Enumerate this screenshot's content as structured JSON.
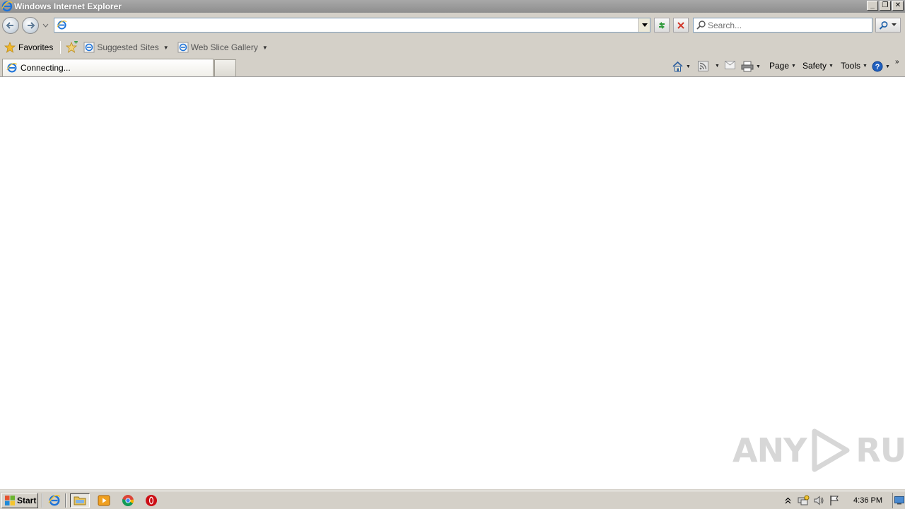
{
  "window": {
    "title": "Windows Internet Explorer",
    "buttons": [
      "minimize",
      "restore",
      "close"
    ]
  },
  "navbar": {
    "address": {
      "value": "",
      "placeholder": ""
    },
    "search": {
      "placeholder": "Search..."
    }
  },
  "favorites_bar": {
    "favorites_label": "Favorites",
    "links": [
      {
        "label": "Suggested Sites"
      },
      {
        "label": "Web Slice Gallery"
      }
    ]
  },
  "tabs": [
    {
      "label": "Connecting..."
    }
  ],
  "command_bar": {
    "page_label": "Page",
    "safety_label": "Safety",
    "tools_label": "Tools"
  },
  "watermark": {
    "text_left": "ANY",
    "text_right": "RUN"
  },
  "taskbar": {
    "start_label": "Start",
    "clock": "4:36 PM",
    "quick_launch": [
      "ie-icon",
      "explorer-icon",
      "media-player-icon",
      "chrome-icon",
      "opera-icon"
    ]
  },
  "colors": {
    "titlebar": "#9a9a9a",
    "chrome": "#d4d0c8",
    "content": "#ffffff"
  }
}
